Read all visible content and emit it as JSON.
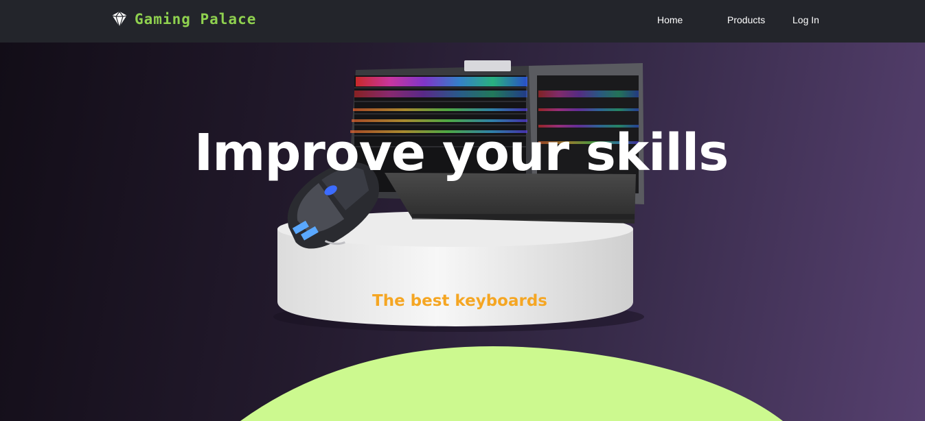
{
  "navbar": {
    "brand": {
      "logo_icon": "diamond-gem-icon",
      "name": "Gaming Palace"
    },
    "links": [
      {
        "label": "Home"
      },
      {
        "label": "Products"
      },
      {
        "label": "Log In"
      }
    ]
  },
  "hero": {
    "title": "Improve your skills",
    "subtitle": "The best keyboards",
    "image": "keyboard-and-mouse-on-pedestal-image"
  },
  "colors": {
    "navbar_bg": "#23252b",
    "brand": "#8fd14f",
    "subtitle": "#f5a623",
    "wave": "#ccf98f",
    "hero_gradient": [
      "#120d17",
      "#56406f"
    ]
  }
}
